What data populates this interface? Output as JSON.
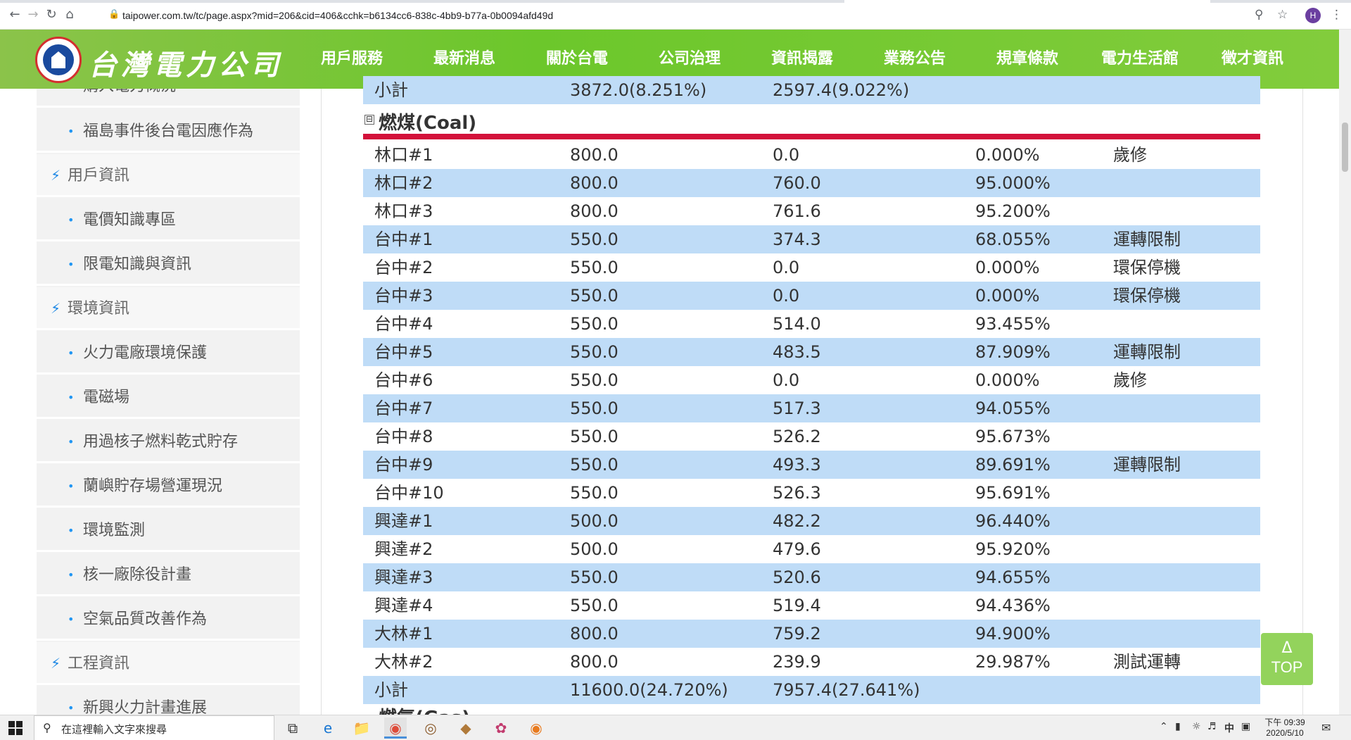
{
  "browser": {
    "url": "taipower.com.tw/tc/page.aspx?mid=206&cid=406&cchk=b6134cc6-838c-4bb9-b77a-0b0094afd49d",
    "profile_initial": "H"
  },
  "site": {
    "name": "台灣電力公司",
    "nav": [
      "用戶服務",
      "最新消息",
      "關於台電",
      "公司治理",
      "資訊揭露",
      "業務公告",
      "規章條款",
      "電力生活館",
      "徵才資訊"
    ]
  },
  "sidebar": {
    "items": [
      {
        "type": "sub",
        "label": "購入電力概況"
      },
      {
        "type": "sub",
        "label": "福島事件後台電因應作為"
      },
      {
        "type": "cat",
        "label": "用戶資訊"
      },
      {
        "type": "sub",
        "label": "電價知識專區"
      },
      {
        "type": "sub",
        "label": "限電知識與資訊"
      },
      {
        "type": "cat",
        "label": "環境資訊"
      },
      {
        "type": "sub",
        "label": "火力電廠環境保護"
      },
      {
        "type": "sub",
        "label": "電磁場"
      },
      {
        "type": "sub",
        "label": "用過核子燃料乾式貯存"
      },
      {
        "type": "sub",
        "label": "蘭嶼貯存場營運現況"
      },
      {
        "type": "sub",
        "label": "環境監測"
      },
      {
        "type": "sub",
        "label": "核一廠除役計畫"
      },
      {
        "type": "sub",
        "label": "空氣品質改善作為"
      },
      {
        "type": "cat",
        "label": "工程資訊"
      },
      {
        "type": "sub",
        "label": "新興火力計畫進展"
      }
    ]
  },
  "table": {
    "prev_subtotal": {
      "label": "小計",
      "capacity": "3872.0(8.251%)",
      "output": "2597.4(9.022%)"
    },
    "section_toggle": "⊟",
    "section_title": "燃煤(Coal)",
    "rows": [
      {
        "unit": "林口#1",
        "capacity": "800.0",
        "output": "0.0",
        "ratio": "0.000%",
        "note": "歲修"
      },
      {
        "unit": "林口#2",
        "capacity": "800.0",
        "output": "760.0",
        "ratio": "95.000%",
        "note": ""
      },
      {
        "unit": "林口#3",
        "capacity": "800.0",
        "output": "761.6",
        "ratio": "95.200%",
        "note": ""
      },
      {
        "unit": "台中#1",
        "capacity": "550.0",
        "output": "374.3",
        "ratio": "68.055%",
        "note": "運轉限制"
      },
      {
        "unit": "台中#2",
        "capacity": "550.0",
        "output": "0.0",
        "ratio": "0.000%",
        "note": "環保停機"
      },
      {
        "unit": "台中#3",
        "capacity": "550.0",
        "output": "0.0",
        "ratio": "0.000%",
        "note": "環保停機"
      },
      {
        "unit": "台中#4",
        "capacity": "550.0",
        "output": "514.0",
        "ratio": "93.455%",
        "note": ""
      },
      {
        "unit": "台中#5",
        "capacity": "550.0",
        "output": "483.5",
        "ratio": "87.909%",
        "note": "運轉限制"
      },
      {
        "unit": "台中#6",
        "capacity": "550.0",
        "output": "0.0",
        "ratio": "0.000%",
        "note": "歲修"
      },
      {
        "unit": "台中#7",
        "capacity": "550.0",
        "output": "517.3",
        "ratio": "94.055%",
        "note": ""
      },
      {
        "unit": "台中#8",
        "capacity": "550.0",
        "output": "526.2",
        "ratio": "95.673%",
        "note": ""
      },
      {
        "unit": "台中#9",
        "capacity": "550.0",
        "output": "493.3",
        "ratio": "89.691%",
        "note": "運轉限制"
      },
      {
        "unit": "台中#10",
        "capacity": "550.0",
        "output": "526.3",
        "ratio": "95.691%",
        "note": ""
      },
      {
        "unit": "興達#1",
        "capacity": "500.0",
        "output": "482.2",
        "ratio": "96.440%",
        "note": ""
      },
      {
        "unit": "興達#2",
        "capacity": "500.0",
        "output": "479.6",
        "ratio": "95.920%",
        "note": ""
      },
      {
        "unit": "興達#3",
        "capacity": "550.0",
        "output": "520.6",
        "ratio": "94.655%",
        "note": ""
      },
      {
        "unit": "興達#4",
        "capacity": "550.0",
        "output": "519.4",
        "ratio": "94.436%",
        "note": ""
      },
      {
        "unit": "大林#1",
        "capacity": "800.0",
        "output": "759.2",
        "ratio": "94.900%",
        "note": ""
      },
      {
        "unit": "大林#2",
        "capacity": "800.0",
        "output": "239.9",
        "ratio": "29.987%",
        "note": "測試運轉"
      }
    ],
    "subtotal": {
      "label": "小計",
      "capacity": "11600.0(24.720%)",
      "output": "7957.4(27.641%)"
    },
    "next_section_title": "燃氣(Gas)"
  },
  "top_button": {
    "arrow": "Δ",
    "label": "TOP"
  },
  "taskbar": {
    "search_placeholder": "在這裡輸入文字來搜尋",
    "ime": "中",
    "time": "下午 09:39",
    "date": "2020/5/10"
  }
}
